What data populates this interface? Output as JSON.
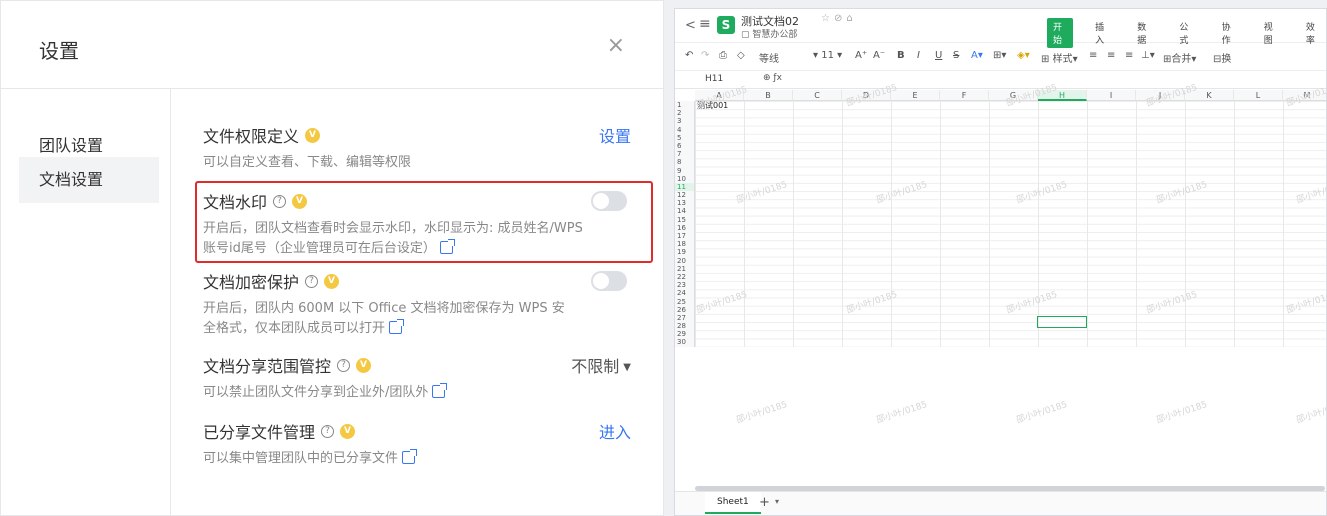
{
  "settings": {
    "title": "设置",
    "close_glyph": "×",
    "nav": [
      {
        "label": "团队设置",
        "active": false
      },
      {
        "label": "文档设置",
        "active": true
      }
    ],
    "items": [
      {
        "title": "文件权限定义",
        "desc": "可以自定义查看、下载、编辑等权限",
        "control": "link",
        "control_label": "设置"
      },
      {
        "title": "文档水印",
        "desc1": "开启后，团队文档查看时会显示水印，水印显示为: 成员姓名/WPS",
        "desc2": "账号id尾号（企业管理员可在后台设定）",
        "control": "toggle",
        "enabled": false,
        "highlighted": true
      },
      {
        "title": "文档加密保护",
        "desc1": "开启后，团队内 600M 以下 Office 文档将加密保存为 WPS 安",
        "desc2": "全格式，仅本团队成员可以打开",
        "control": "toggle",
        "enabled": false
      },
      {
        "title": "文档分享范围管控",
        "desc": "可以禁止团队文件分享到企业外/团队外",
        "control": "dropdown",
        "control_label": "不限制"
      },
      {
        "title": "已分享文件管理",
        "desc": "可以集中管理团队中的已分享文件",
        "control": "link",
        "control_label": "进入"
      }
    ],
    "accent_color": "#3a78f2",
    "highlight_color": "#e02b2b"
  },
  "spreadsheet": {
    "doc_name": "测试文档02",
    "doc_path": "智慧办公部",
    "tabs": [
      "开始",
      "插入",
      "数据",
      "公式",
      "协作",
      "视图",
      "效率"
    ],
    "active_tab": "开始",
    "toolbar": {
      "font": "等线",
      "font_size": "11",
      "style_btn": "样式",
      "merge_btn": "合并",
      "wrap_btn": "换"
    },
    "name_box": "H11",
    "columns": [
      "A",
      "B",
      "C",
      "D",
      "E",
      "F",
      "G",
      "H",
      "I",
      "J",
      "K",
      "L",
      "M"
    ],
    "selected_column": "H",
    "selected_row": 11,
    "rows": 30,
    "cell_a1": "测试001",
    "watermark_text": "邵小叶/0185",
    "sheet_tab": "Sheet1",
    "add_sheet": "+",
    "brand_color": "#1fab5e"
  }
}
